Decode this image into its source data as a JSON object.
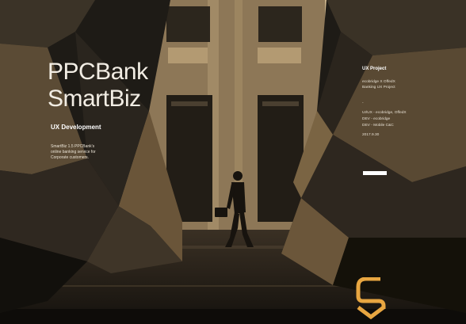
{
  "hero": {
    "title_line1": "PPCBank",
    "title_line2": "SmartBiz",
    "subtitle": "UX  Development",
    "description": [
      "SmartBiz 1.5 PPCBank's",
      "online banking service for",
      "Corporate customers."
    ]
  },
  "project": {
    "heading": "UX Project",
    "client_lines": [
      "ecobridge X OffedX",
      "Banking UX Project"
    ],
    "dash": "-",
    "credit_lines": [
      "UI/UX - ecobridge, OffedX",
      "DEV - ecobridge",
      "DEV - Mobile C&C"
    ],
    "year": "2017.9.30"
  },
  "colors": {
    "tone_dark": "#1c1a16",
    "tone_mid": "#6b5a3e",
    "tone_light": "#c7ad7e",
    "logo_accent": "#e8a641",
    "text": "#f2ede4"
  },
  "icons": [
    "ppc-logo-icon"
  ]
}
